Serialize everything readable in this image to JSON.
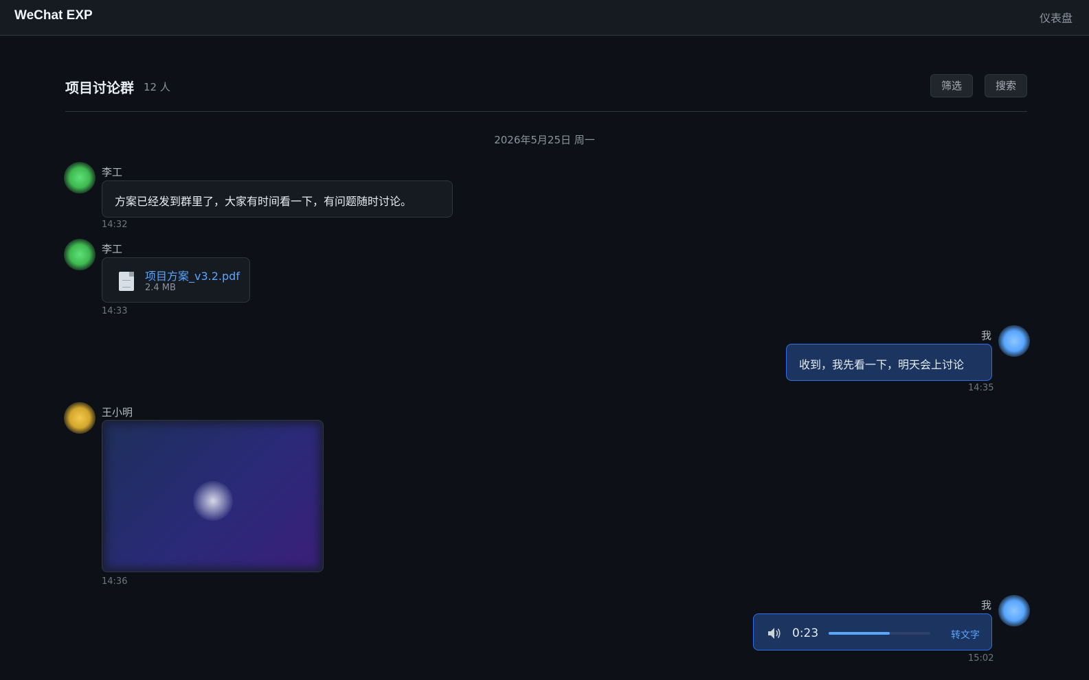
{
  "topbar": {
    "brand": "WeChat EXP",
    "nav_dashboard": "仪表盘"
  },
  "chat": {
    "title": "项目讨论群",
    "member_count": "12 人",
    "filter_label": "筛选",
    "search_label": "搜索",
    "date_divider": "2026年5月25日 周一"
  },
  "messages": [
    {
      "sender": "李工",
      "type": "text",
      "text": "方案已经发到群里了，大家有时间看一下，有问题随时讨论。",
      "time": "14:32"
    },
    {
      "sender": "李工",
      "type": "file",
      "file_name": "项目方案_v3.2.pdf",
      "file_size": "2.4 MB",
      "time": "14:33"
    },
    {
      "sender": "我",
      "type": "text",
      "text": "收到，我先看一下，明天会上讨论",
      "time": "14:35"
    },
    {
      "sender": "王小明",
      "type": "image",
      "time": "14:36"
    },
    {
      "sender": "我",
      "type": "voice",
      "duration": "0:23",
      "progress": 0.6,
      "action": "转文字",
      "time": "15:02"
    }
  ],
  "colors": {
    "accent": "#58a6ff",
    "avatar_li": "#3fb950",
    "avatar_wang": "#d4a72c",
    "avatar_me": "#58a6ff"
  },
  "icons": {
    "file": "file-icon",
    "voice": "speaker-icon"
  }
}
